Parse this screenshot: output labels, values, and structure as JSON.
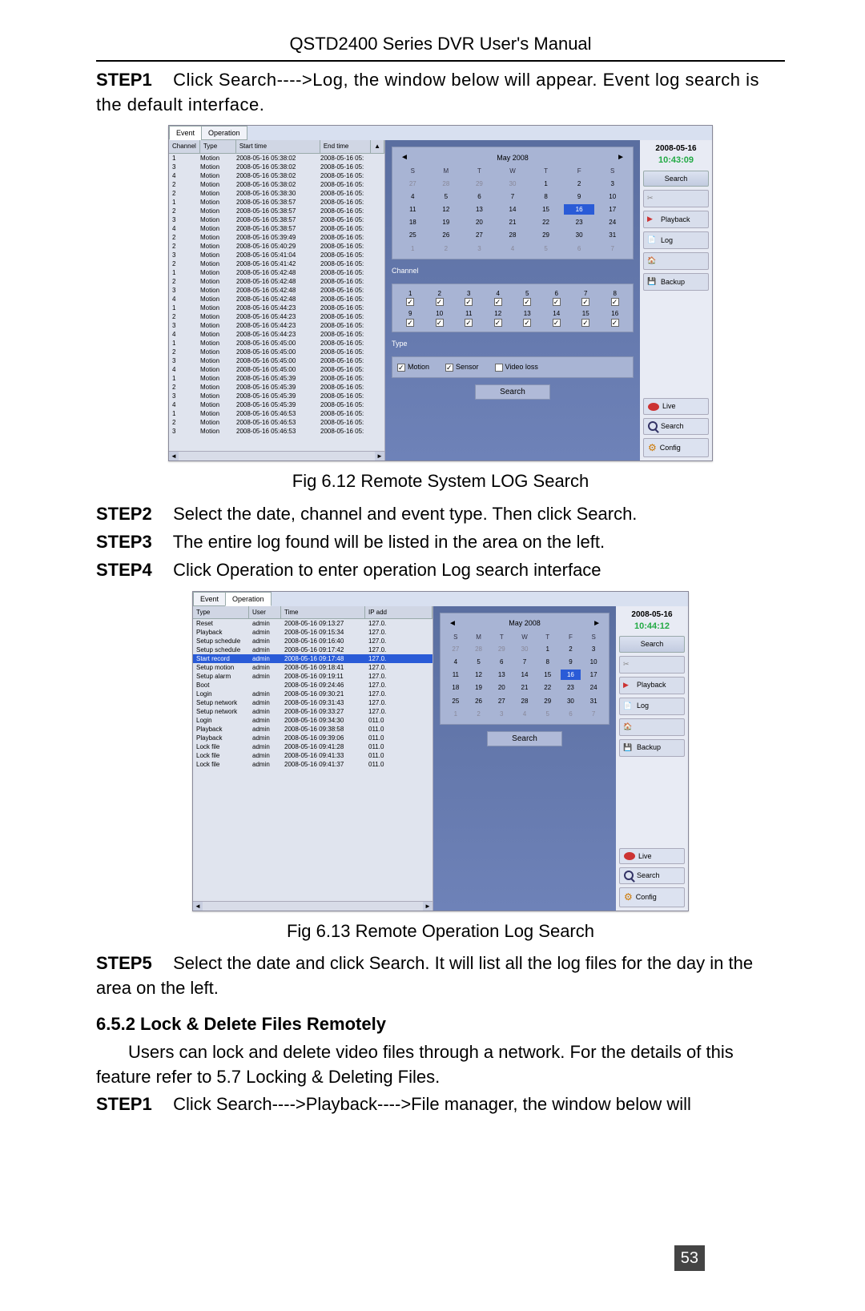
{
  "header_title": "QSTD2400 Series DVR User's Manual",
  "step1_label": "STEP1",
  "step1_text": "Click Search---->Log, the window below will appear. Event log search is the default interface.",
  "fig1": {
    "tabs": [
      "Event",
      "Operation"
    ],
    "table_headers": [
      "Channel",
      "Type",
      "Start time",
      "End time"
    ],
    "rows": [
      {
        "ch": "1",
        "type": "Motion",
        "start": "2008-05-16 05:38:02",
        "end": "2008-05-16 05:"
      },
      {
        "ch": "3",
        "type": "Motion",
        "start": "2008-05-16 05:38:02",
        "end": "2008-05-16 05:"
      },
      {
        "ch": "4",
        "type": "Motion",
        "start": "2008-05-16 05:38:02",
        "end": "2008-05-16 05:"
      },
      {
        "ch": "2",
        "type": "Motion",
        "start": "2008-05-16 05:38:02",
        "end": "2008-05-16 05:"
      },
      {
        "ch": "2",
        "type": "Motion",
        "start": "2008-05-16 05:38:30",
        "end": "2008-05-16 05:"
      },
      {
        "ch": "1",
        "type": "Motion",
        "start": "2008-05-16 05:38:57",
        "end": "2008-05-16 05:"
      },
      {
        "ch": "2",
        "type": "Motion",
        "start": "2008-05-16 05:38:57",
        "end": "2008-05-16 05:"
      },
      {
        "ch": "3",
        "type": "Motion",
        "start": "2008-05-16 05:38:57",
        "end": "2008-05-16 05:"
      },
      {
        "ch": "4",
        "type": "Motion",
        "start": "2008-05-16 05:38:57",
        "end": "2008-05-16 05:"
      },
      {
        "ch": "2",
        "type": "Motion",
        "start": "2008-05-16 05:39:49",
        "end": "2008-05-16 05:"
      },
      {
        "ch": "2",
        "type": "Motion",
        "start": "2008-05-16 05:40:29",
        "end": "2008-05-16 05:"
      },
      {
        "ch": "3",
        "type": "Motion",
        "start": "2008-05-16 05:41:04",
        "end": "2008-05-16 05:"
      },
      {
        "ch": "2",
        "type": "Motion",
        "start": "2008-05-16 05:41:42",
        "end": "2008-05-16 05:"
      },
      {
        "ch": "1",
        "type": "Motion",
        "start": "2008-05-16 05:42:48",
        "end": "2008-05-16 05:"
      },
      {
        "ch": "2",
        "type": "Motion",
        "start": "2008-05-16 05:42:48",
        "end": "2008-05-16 05:"
      },
      {
        "ch": "3",
        "type": "Motion",
        "start": "2008-05-16 05:42:48",
        "end": "2008-05-16 05:"
      },
      {
        "ch": "4",
        "type": "Motion",
        "start": "2008-05-16 05:42:48",
        "end": "2008-05-16 05:"
      },
      {
        "ch": "1",
        "type": "Motion",
        "start": "2008-05-16 05:44:23",
        "end": "2008-05-16 05:"
      },
      {
        "ch": "2",
        "type": "Motion",
        "start": "2008-05-16 05:44:23",
        "end": "2008-05-16 05:"
      },
      {
        "ch": "3",
        "type": "Motion",
        "start": "2008-05-16 05:44:23",
        "end": "2008-05-16 05:"
      },
      {
        "ch": "4",
        "type": "Motion",
        "start": "2008-05-16 05:44:23",
        "end": "2008-05-16 05:"
      },
      {
        "ch": "1",
        "type": "Motion",
        "start": "2008-05-16 05:45:00",
        "end": "2008-05-16 05:"
      },
      {
        "ch": "2",
        "type": "Motion",
        "start": "2008-05-16 05:45:00",
        "end": "2008-05-16 05:"
      },
      {
        "ch": "3",
        "type": "Motion",
        "start": "2008-05-16 05:45:00",
        "end": "2008-05-16 05:"
      },
      {
        "ch": "4",
        "type": "Motion",
        "start": "2008-05-16 05:45:00",
        "end": "2008-05-16 05:"
      },
      {
        "ch": "1",
        "type": "Motion",
        "start": "2008-05-16 05:45:39",
        "end": "2008-05-16 05:"
      },
      {
        "ch": "2",
        "type": "Motion",
        "start": "2008-05-16 05:45:39",
        "end": "2008-05-16 05:"
      },
      {
        "ch": "3",
        "type": "Motion",
        "start": "2008-05-16 05:45:39",
        "end": "2008-05-16 05:"
      },
      {
        "ch": "4",
        "type": "Motion",
        "start": "2008-05-16 05:45:39",
        "end": "2008-05-16 05:"
      },
      {
        "ch": "1",
        "type": "Motion",
        "start": "2008-05-16 05:46:53",
        "end": "2008-05-16 05:"
      },
      {
        "ch": "2",
        "type": "Motion",
        "start": "2008-05-16 05:46:53",
        "end": "2008-05-16 05:"
      },
      {
        "ch": "3",
        "type": "Motion",
        "start": "2008-05-16 05:46:53",
        "end": "2008-05-16 05:"
      }
    ],
    "clock_date": "2008-05-16",
    "clock_time": "10:43:09",
    "cal_month": "May 2008",
    "dow": [
      "S",
      "M",
      "T",
      "W",
      "T",
      "F",
      "S"
    ],
    "days_dim_pre": [
      "27",
      "28",
      "29",
      "30"
    ],
    "days_main": [
      "1",
      "2",
      "3",
      "4",
      "5",
      "6",
      "7",
      "8",
      "9",
      "10",
      "11",
      "12",
      "13",
      "14",
      "15",
      "16",
      "17",
      "18",
      "19",
      "20",
      "21",
      "22",
      "23",
      "24",
      "25",
      "26",
      "27",
      "28",
      "29",
      "30",
      "31"
    ],
    "days_dim_post": [
      "1",
      "2",
      "3",
      "4",
      "5",
      "6",
      "7"
    ],
    "selected_day": "16",
    "channel_label": "Channel",
    "channels": [
      "1",
      "2",
      "3",
      "4",
      "5",
      "6",
      "7",
      "8",
      "9",
      "10",
      "11",
      "12",
      "13",
      "14",
      "15",
      "16"
    ],
    "type_label": "Type",
    "type_motion": "Motion",
    "type_sensor": "Sensor",
    "type_video_loss": "Video loss",
    "search_btn": "Search",
    "side_search": "Search",
    "side_playback": "Playback",
    "side_log": "Log",
    "side_backup": "Backup",
    "side_live": "Live",
    "side_bottom_search": "Search",
    "side_config": "Config"
  },
  "fig1_caption": "Fig 6.12 Remote System LOG Search",
  "step2_label": "STEP2",
  "step2_text": "Select the date, channel and event type. Then click Search.",
  "step3_label": "STEP3",
  "step3_text": "The entire log found will be listed in the area on the left.",
  "step4_label": "STEP4",
  "step4_text": "Click Operation to enter operation Log search interface",
  "fig2": {
    "tabs": [
      "Event",
      "Operation"
    ],
    "table_headers": [
      "Type",
      "User",
      "Time",
      "IP add"
    ],
    "rows": [
      {
        "type": "Reset",
        "user": "admin",
        "time": "2008-05-16 09:13:27",
        "ip": "127.0."
      },
      {
        "type": "Playback",
        "user": "admin",
        "time": "2008-05-16 09:15:34",
        "ip": "127.0."
      },
      {
        "type": "Setup schedule",
        "user": "admin",
        "time": "2008-05-16 09:16:40",
        "ip": "127.0."
      },
      {
        "type": "Setup schedule",
        "user": "admin",
        "time": "2008-05-16 09:17:42",
        "ip": "127.0."
      },
      {
        "type": "Start record",
        "user": "admin",
        "time": "2008-05-16 09:17:48",
        "ip": "127.0.",
        "selected": true
      },
      {
        "type": "Setup motion",
        "user": "admin",
        "time": "2008-05-16 09:18:41",
        "ip": "127.0."
      },
      {
        "type": "Setup alarm",
        "user": "admin",
        "time": "2008-05-16 09:19:11",
        "ip": "127.0."
      },
      {
        "type": "Boot",
        "user": "",
        "time": "2008-05-16 09:24:46",
        "ip": "127.0."
      },
      {
        "type": "Login",
        "user": "admin",
        "time": "2008-05-16 09:30:21",
        "ip": "127.0."
      },
      {
        "type": "Setup network",
        "user": "admin",
        "time": "2008-05-16 09:31:43",
        "ip": "127.0."
      },
      {
        "type": "Setup network",
        "user": "admin",
        "time": "2008-05-16 09:33:27",
        "ip": "127.0."
      },
      {
        "type": "Login",
        "user": "admin",
        "time": "2008-05-16 09:34:30",
        "ip": "011.0"
      },
      {
        "type": "Playback",
        "user": "admin",
        "time": "2008-05-16 09:38:58",
        "ip": "011.0"
      },
      {
        "type": "Playback",
        "user": "admin",
        "time": "2008-05-16 09:39:06",
        "ip": "011.0"
      },
      {
        "type": "Lock file",
        "user": "admin",
        "time": "2008-05-16 09:41:28",
        "ip": "011.0"
      },
      {
        "type": "Lock file",
        "user": "admin",
        "time": "2008-05-16 09:41:33",
        "ip": "011.0"
      },
      {
        "type": "Lock file",
        "user": "admin",
        "time": "2008-05-16 09:41:37",
        "ip": "011.0"
      }
    ],
    "clock_date": "2008-05-16",
    "clock_time": "10:44:12",
    "cal_month": "May 2008",
    "search_btn": "Search",
    "side_search": "Search",
    "side_playback": "Playback",
    "side_log": "Log",
    "side_backup": "Backup",
    "side_live": "Live",
    "side_bottom_search": "Search",
    "side_config": "Config"
  },
  "fig2_caption": "Fig 6.13 Remote Operation Log Search",
  "step5_label": "STEP5",
  "step5_text": "Select the date and click Search. It will list all the log files for the day in the area on the left.",
  "section_652": "6.5.2  Lock & Delete Files Remotely",
  "para_652": "Users can lock and delete video files through a network. For the details of this feature refer to 5.7 Locking & Deleting Files.",
  "step1b_label": "STEP1",
  "step1b_text": "Click Search---->Playback---->File manager, the window below will",
  "page_number": "53"
}
